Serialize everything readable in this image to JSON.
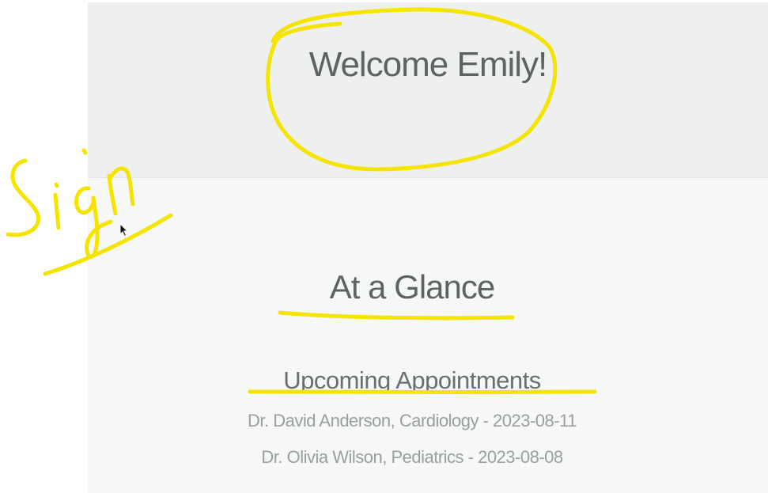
{
  "hero": {
    "welcome": "Welcome Emily!"
  },
  "glance": {
    "title": "At a Glance",
    "upcoming_heading": "Upcoming Appointments",
    "appointments": [
      "Dr. David Anderson, Cardiology - 2023-08-11",
      "Dr. Olivia Wilson, Pediatrics - 2023-08-08"
    ]
  },
  "annotations": {
    "color": "#f5e400",
    "handwritten_text": "Sign"
  },
  "colors": {
    "hero_bg": "#eef0ef",
    "page_bg": "#f6f7f7",
    "heading_text": "#5e6264",
    "muted_text": "#9a9ea0"
  }
}
